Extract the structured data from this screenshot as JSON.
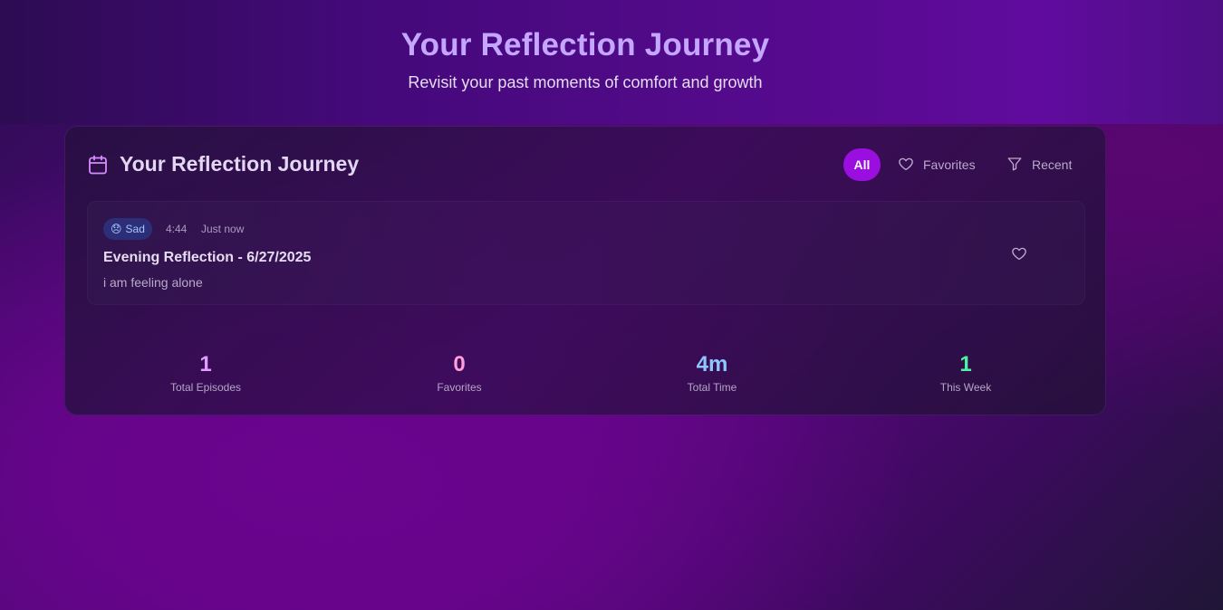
{
  "hero": {
    "title": "Your Reflection Journey",
    "subtitle": "Revisit your past moments of comfort and growth"
  },
  "panel": {
    "icon": "calendar-icon",
    "title": "Your Reflection Journey",
    "filters": {
      "all_label": "All",
      "favorites_label": "Favorites",
      "favorites_icon": "heart-icon",
      "recent_label": "Recent",
      "recent_icon": "filter-icon"
    }
  },
  "entries": [
    {
      "mood_emoji": "😞",
      "mood_label": "Sad",
      "duration": "4:44",
      "time": "Just now",
      "title": "Evening Reflection - 6/27/2025",
      "text": "i am feeling alone",
      "favorite_icon": "heart-outline-icon"
    }
  ],
  "stats": [
    {
      "value": "1",
      "label": "Total Episodes",
      "color": "#e29bff"
    },
    {
      "value": "0",
      "label": "Favorites",
      "color": "#ff9ed9"
    },
    {
      "value": "4m",
      "label": "Total Time",
      "color": "#8ec7ff"
    },
    {
      "value": "1",
      "label": "This Week",
      "color": "#4ef0a6"
    }
  ],
  "colors": {
    "accent": "#9b0ee0",
    "hero_title": "#c4a6ff",
    "mood_badge_bg": "#2c2f78",
    "mood_badge_text": "#a7c4ff"
  }
}
